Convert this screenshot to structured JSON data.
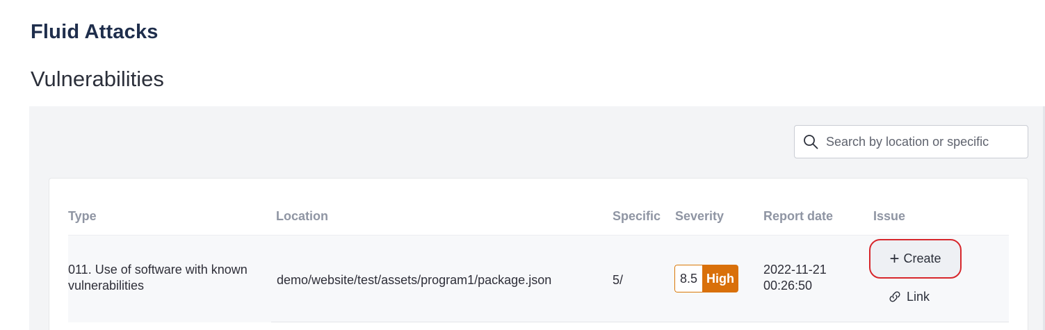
{
  "header": {
    "app_title": "Fluid Attacks",
    "section_title": "Vulnerabilities"
  },
  "search": {
    "placeholder": "Search by location or specific",
    "value": "",
    "icon": "search-icon"
  },
  "table": {
    "columns": [
      "Type",
      "Location",
      "Specific",
      "Severity",
      "Report date",
      "Issue"
    ],
    "rows": [
      {
        "type_line1": "011. Use of software with known",
        "type_line2": "vulnerabilities",
        "location": "demo/website/test/assets/program1/package.json",
        "specific": "5/",
        "severity_score": "8.5",
        "severity_label": "High",
        "report_date_line1": "2022-11-21",
        "report_date_line2": "00:26:50",
        "issue_create_label": "Create",
        "issue_link_label": "Link"
      }
    ]
  },
  "colors": {
    "severity_high": "#d9700a",
    "highlight_outline": "#d7262b",
    "title": "#1f2e4c"
  }
}
